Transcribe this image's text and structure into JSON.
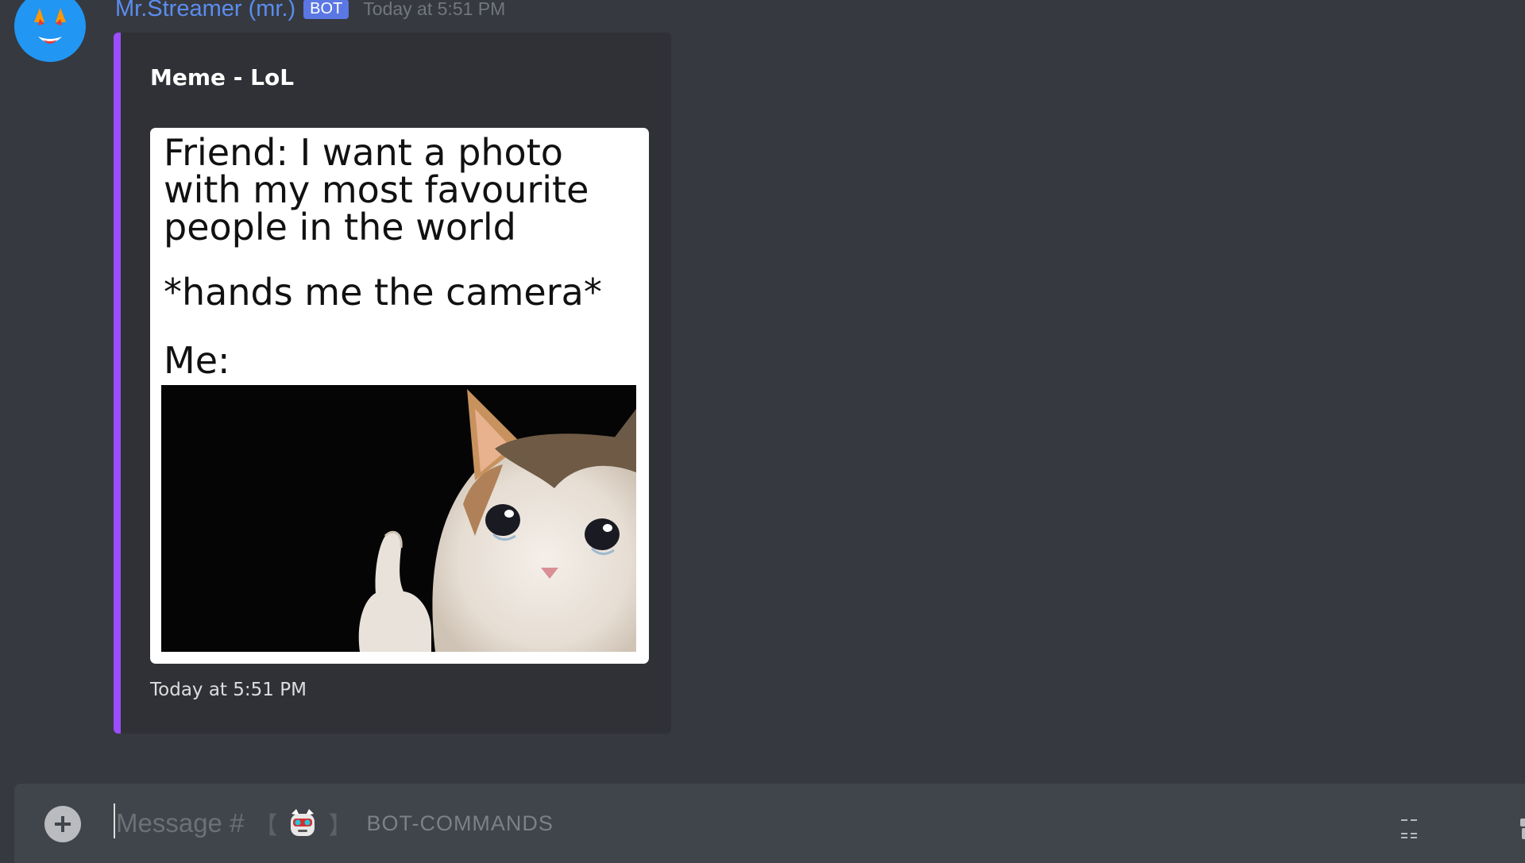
{
  "message": {
    "username": "Mr.Streamer (mr.)",
    "bot_tag": "BOT",
    "timestamp": "Today at 5:51 PM",
    "avatar_icon": "devil-emoji-avatar-icon"
  },
  "embed": {
    "accent_color": "#9b4dff",
    "title": "Meme - LoL",
    "meme_text": "Friend: I want a photo\nwith my most favourite\npeople in the world",
    "meme_action": "*hands me the camera*",
    "meme_me": "Me:",
    "meme_image_icon": "crying-cat-thumbs-up-image",
    "footer_timestamp": "Today at 5:51 PM"
  },
  "input": {
    "placeholder_prefix": "Message #",
    "bracket_open": "【",
    "bracket_close": "】",
    "channel_emoji": "robot-face-icon",
    "channel_name": "BOT-COMMANDS",
    "add_icon": "plus-circle-icon",
    "gif_icon": "gif-icon",
    "gift_icon": "gift-icon"
  },
  "colors": {
    "background": "#36393f",
    "embed_bg": "#2f3136",
    "username": "#5b8def",
    "bot_tag": "#5b77e4",
    "input_bg": "#40444b"
  }
}
